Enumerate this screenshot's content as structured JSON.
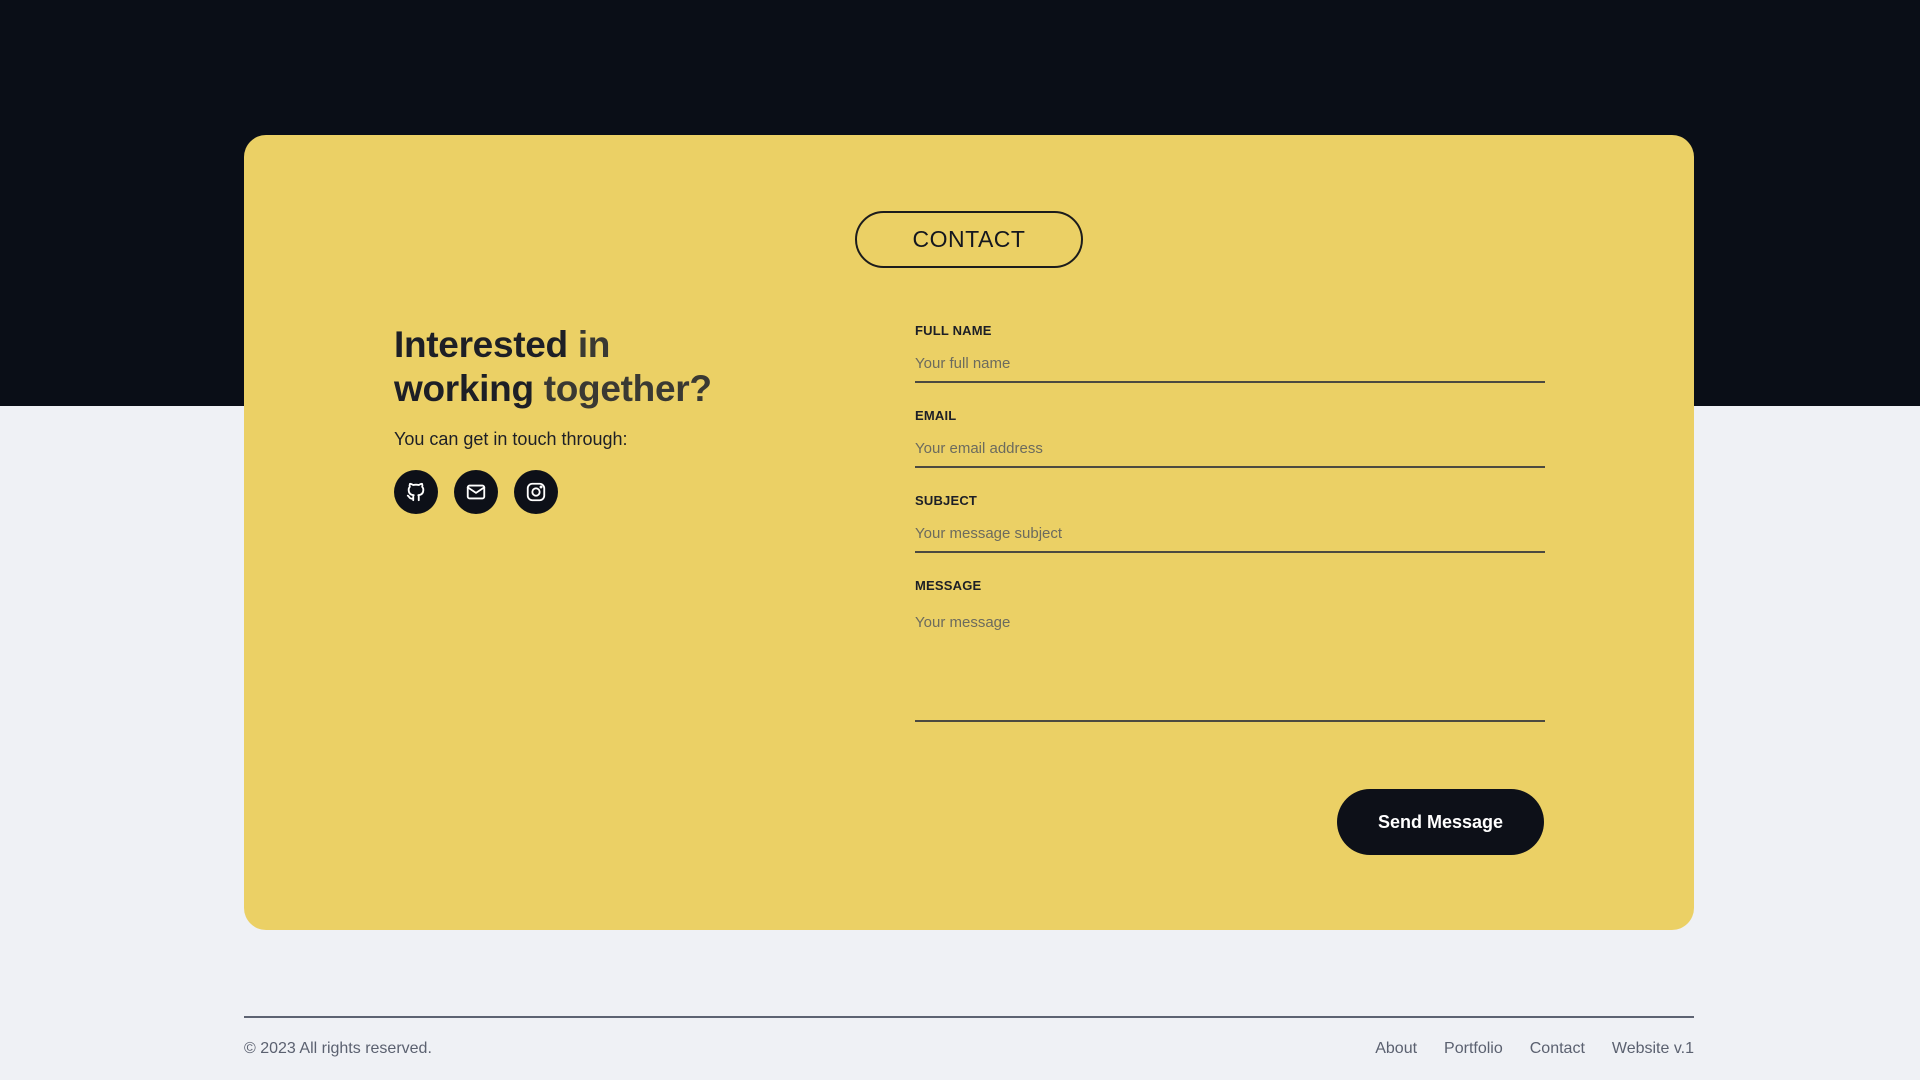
{
  "contact_section": {
    "badge": "CONTACT",
    "headline_line1_a": "Interested",
    "headline_line1_b": " in",
    "headline_line2_a": "working ",
    "headline_line2_b": "together?",
    "subtext": "You can get in touch through:",
    "socials": [
      {
        "icon": "github-icon"
      },
      {
        "icon": "mail-icon"
      },
      {
        "icon": "instagram-icon"
      }
    ]
  },
  "form": {
    "full_name": {
      "label": "FULL NAME",
      "placeholder": "Your full name",
      "value": ""
    },
    "email": {
      "label": "EMAIL",
      "placeholder": "Your email address",
      "value": ""
    },
    "subject": {
      "label": "SUBJECT",
      "placeholder": "Your message subject",
      "value": ""
    },
    "message": {
      "label": "MESSAGE",
      "placeholder": "Your message",
      "value": ""
    },
    "submit_label": "Send Message"
  },
  "footer": {
    "copyright": "© 2023 All rights reserved.",
    "links": [
      "About",
      "Portfolio",
      "Contact",
      "Website v.1"
    ]
  },
  "colors": {
    "card": "#ebd065",
    "dark": "#0a0e17",
    "page": "#eff1f5"
  }
}
